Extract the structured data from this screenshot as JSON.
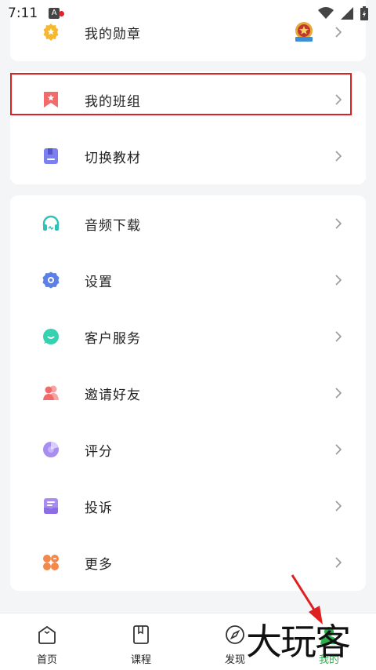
{
  "status": {
    "time": "7:11",
    "notif_letter": "A"
  },
  "menu_top": {
    "label": "我的勋章"
  },
  "menu_group1": [
    {
      "label": "我的班组"
    },
    {
      "label": "切换教材"
    }
  ],
  "menu_group2": [
    {
      "label": "音频下载"
    },
    {
      "label": "设置"
    },
    {
      "label": "客户服务"
    },
    {
      "label": "邀请好友"
    },
    {
      "label": "评分"
    },
    {
      "label": "投诉"
    },
    {
      "label": "更多"
    }
  ],
  "tabs": [
    {
      "label": "首页"
    },
    {
      "label": "课程"
    },
    {
      "label": "发现"
    },
    {
      "label": "我的"
    }
  ],
  "watermark": "大玩客",
  "colors": {
    "accent_green": "#2bb24c",
    "highlight_red": "#e02020"
  }
}
